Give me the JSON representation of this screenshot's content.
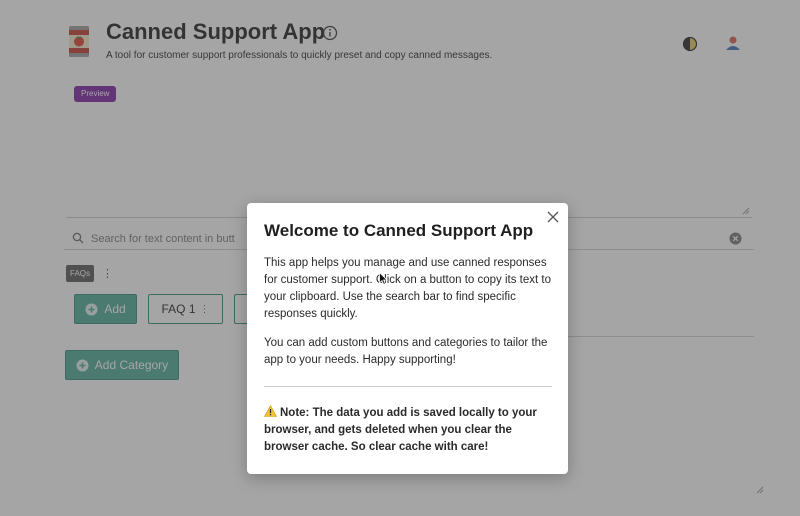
{
  "header": {
    "title": "Canned Support App",
    "subtitle": "A tool for customer support professionals to quickly preset and copy canned messages.",
    "badge": "Preview"
  },
  "search": {
    "placeholder": "Search for text content in butt"
  },
  "category": {
    "label": "FAQs",
    "buttons": [
      {
        "label": "Add"
      },
      {
        "label": "FAQ 1"
      }
    ]
  },
  "add_category_label": "Add Category",
  "modal": {
    "title": "Welcome to Canned Support App",
    "paragraph1": "This app helps you manage and use canned responses for customer support. Click on a button to copy its text to your clipboard. Use the search bar to find specific responses quickly.",
    "paragraph2": "You can add custom buttons and categories to tailor the app to your needs. Happy supporting!",
    "note": "Note: The data you add is saved locally to your browser, and gets deleted when you clear the browser cache. So clear cache with care!"
  },
  "colors": {
    "accent": "#4aa895",
    "accent_border": "#2f8a77",
    "badge": "#7a1fa2",
    "backdrop": "rgba(75,75,75,0.5)"
  },
  "icons": [
    "tomato-can-logo-icon",
    "info-icon",
    "theme-toggle-icon",
    "user-icon",
    "search-icon",
    "clear-icon",
    "kebab-menu-icon",
    "plus-circle-icon",
    "close-icon",
    "warning-icon",
    "cursor-icon"
  ]
}
